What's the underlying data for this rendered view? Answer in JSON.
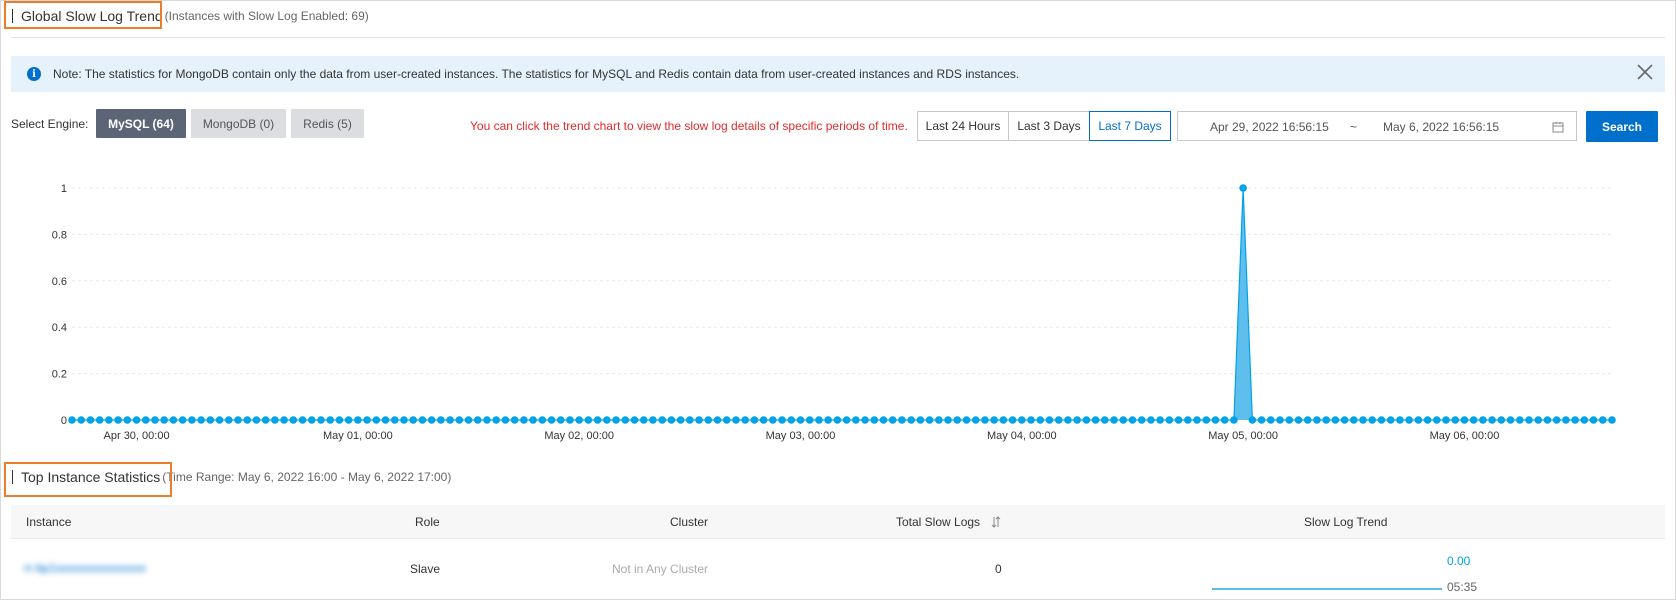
{
  "trend": {
    "title": "Global Slow Log Trend",
    "subtitle": "(Instances with Slow Log Enabled: 69)"
  },
  "notice": {
    "text": "Note: The statistics for MongoDB contain only the data from user-created instances. The statistics for MySQL and Redis contain data from user-created instances and RDS instances."
  },
  "engine": {
    "label": "Select Engine:",
    "options": [
      "MySQL (64)",
      "MongoDB (0)",
      "Redis (5)"
    ],
    "selected": "MySQL (64)"
  },
  "hint": "You can click the trend chart to view the slow log details of specific periods of time.",
  "time_ranges": {
    "options": [
      "Last 24 Hours",
      "Last 3 Days",
      "Last 7 Days"
    ],
    "selected": "Last 7 Days"
  },
  "date_range": {
    "start": "Apr 29, 2022 16:56:15",
    "separator": "~",
    "end": "May 6, 2022 16:56:15"
  },
  "search_label": "Search",
  "chart_data": {
    "type": "area",
    "y_ticks": [
      "1",
      "0.8",
      "0.6",
      "0.4",
      "0.2",
      "0"
    ],
    "x_ticks": [
      "Apr 30, 00:00",
      "May 01, 00:00",
      "May 02, 00:00",
      "May 03, 00:00",
      "May 04, 00:00",
      "May 05, 00:00",
      "May 06, 00:00"
    ],
    "ylim": [
      0,
      1
    ],
    "start": "2022-04-29T17:00",
    "interval_hours": 1,
    "num_points": 168,
    "spike_index": 127,
    "spike_time": "May 4, 2022 ~16:00",
    "spike_value": 1,
    "baseline_value": 0,
    "color": "#00a2e8",
    "grid": true
  },
  "top": {
    "title": "Top Instance Statistics",
    "subtitle": "(Time Range: May 6, 2022 16:00 - May 6, 2022 17:00)",
    "columns": [
      "Instance",
      "Role",
      "Cluster",
      "Total Slow Logs",
      "Slow Log Trend"
    ],
    "rows": [
      {
        "instance": "rr-bp1xxxxxxxxxxxxxxx",
        "role": "Slave",
        "cluster": "Not in Any Cluster",
        "total": "0",
        "trend_value": "0.00",
        "trend_time": "05:35"
      }
    ]
  },
  "colors": {
    "accent": "#0070cc",
    "highlight_box": "#ee7d2a",
    "hint": "#e02c2c",
    "series": "#00a2e8"
  }
}
